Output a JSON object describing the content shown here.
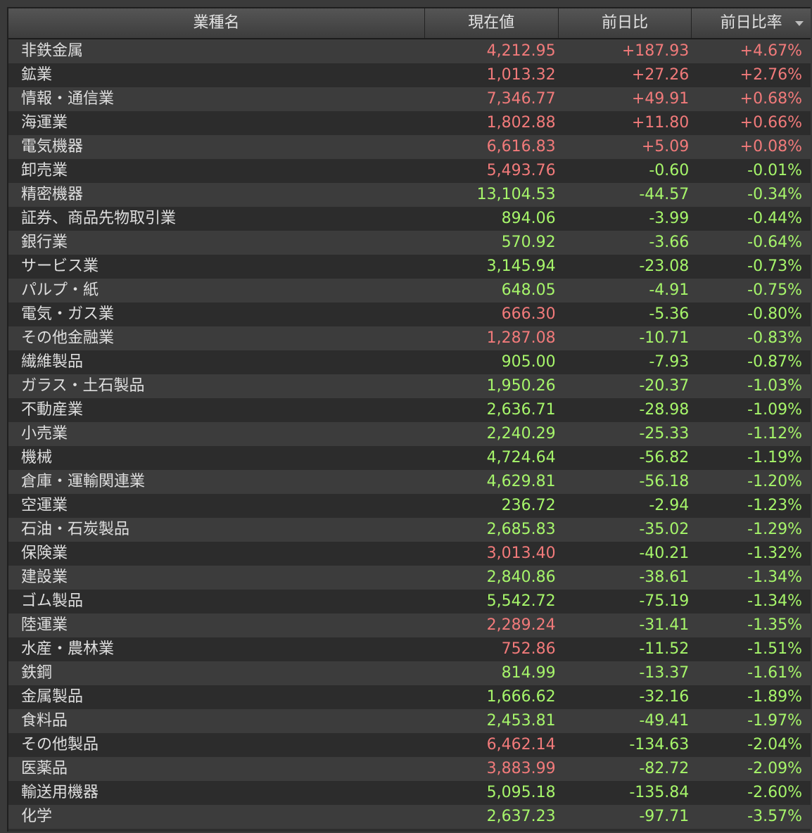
{
  "headers": {
    "name": "業種名",
    "price": "現在値",
    "change": "前日比",
    "change_pct": "前日比率"
  },
  "colors": {
    "up": "#f17a7a",
    "down": "#a6f56a"
  },
  "rows": [
    {
      "name": "非鉄金属",
      "price": "4,212.95",
      "change": "+187.93",
      "pct": "+4.67%",
      "price_color": "red",
      "chg_color": "red"
    },
    {
      "name": "鉱業",
      "price": "1,013.32",
      "change": "+27.26",
      "pct": "+2.76%",
      "price_color": "red",
      "chg_color": "red"
    },
    {
      "name": "情報・通信業",
      "price": "7,346.77",
      "change": "+49.91",
      "pct": "+0.68%",
      "price_color": "red",
      "chg_color": "red"
    },
    {
      "name": "海運業",
      "price": "1,802.88",
      "change": "+11.80",
      "pct": "+0.66%",
      "price_color": "red",
      "chg_color": "red"
    },
    {
      "name": "電気機器",
      "price": "6,616.83",
      "change": "+5.09",
      "pct": "+0.08%",
      "price_color": "red",
      "chg_color": "red"
    },
    {
      "name": "卸売業",
      "price": "5,493.76",
      "change": "-0.60",
      "pct": "-0.01%",
      "price_color": "red",
      "chg_color": "green"
    },
    {
      "name": "精密機器",
      "price": "13,104.53",
      "change": "-44.57",
      "pct": "-0.34%",
      "price_color": "green",
      "chg_color": "green"
    },
    {
      "name": "証券、商品先物取引業",
      "price": "894.06",
      "change": "-3.99",
      "pct": "-0.44%",
      "price_color": "green",
      "chg_color": "green"
    },
    {
      "name": "銀行業",
      "price": "570.92",
      "change": "-3.66",
      "pct": "-0.64%",
      "price_color": "green",
      "chg_color": "green"
    },
    {
      "name": "サービス業",
      "price": "3,145.94",
      "change": "-23.08",
      "pct": "-0.73%",
      "price_color": "green",
      "chg_color": "green"
    },
    {
      "name": "パルプ・紙",
      "price": "648.05",
      "change": "-4.91",
      "pct": "-0.75%",
      "price_color": "green",
      "chg_color": "green"
    },
    {
      "name": "電気・ガス業",
      "price": "666.30",
      "change": "-5.36",
      "pct": "-0.80%",
      "price_color": "red",
      "chg_color": "green"
    },
    {
      "name": "その他金融業",
      "price": "1,287.08",
      "change": "-10.71",
      "pct": "-0.83%",
      "price_color": "red",
      "chg_color": "green"
    },
    {
      "name": "繊維製品",
      "price": "905.00",
      "change": "-7.93",
      "pct": "-0.87%",
      "price_color": "green",
      "chg_color": "green"
    },
    {
      "name": "ガラス・土石製品",
      "price": "1,950.26",
      "change": "-20.37",
      "pct": "-1.03%",
      "price_color": "green",
      "chg_color": "green"
    },
    {
      "name": "不動産業",
      "price": "2,636.71",
      "change": "-28.98",
      "pct": "-1.09%",
      "price_color": "green",
      "chg_color": "green"
    },
    {
      "name": "小売業",
      "price": "2,240.29",
      "change": "-25.33",
      "pct": "-1.12%",
      "price_color": "green",
      "chg_color": "green"
    },
    {
      "name": "機械",
      "price": "4,724.64",
      "change": "-56.82",
      "pct": "-1.19%",
      "price_color": "green",
      "chg_color": "green"
    },
    {
      "name": "倉庫・運輸関連業",
      "price": "4,629.81",
      "change": "-56.18",
      "pct": "-1.20%",
      "price_color": "green",
      "chg_color": "green"
    },
    {
      "name": "空運業",
      "price": "236.72",
      "change": "-2.94",
      "pct": "-1.23%",
      "price_color": "green",
      "chg_color": "green"
    },
    {
      "name": "石油・石炭製品",
      "price": "2,685.83",
      "change": "-35.02",
      "pct": "-1.29%",
      "price_color": "green",
      "chg_color": "green"
    },
    {
      "name": "保険業",
      "price": "3,013.40",
      "change": "-40.21",
      "pct": "-1.32%",
      "price_color": "red",
      "chg_color": "green"
    },
    {
      "name": "建設業",
      "price": "2,840.86",
      "change": "-38.61",
      "pct": "-1.34%",
      "price_color": "green",
      "chg_color": "green"
    },
    {
      "name": "ゴム製品",
      "price": "5,542.72",
      "change": "-75.19",
      "pct": "-1.34%",
      "price_color": "green",
      "chg_color": "green"
    },
    {
      "name": "陸運業",
      "price": "2,289.24",
      "change": "-31.41",
      "pct": "-1.35%",
      "price_color": "red",
      "chg_color": "green"
    },
    {
      "name": "水産・農林業",
      "price": "752.86",
      "change": "-11.52",
      "pct": "-1.51%",
      "price_color": "red",
      "chg_color": "green"
    },
    {
      "name": "鉄鋼",
      "price": "814.99",
      "change": "-13.37",
      "pct": "-1.61%",
      "price_color": "green",
      "chg_color": "green"
    },
    {
      "name": "金属製品",
      "price": "1,666.62",
      "change": "-32.16",
      "pct": "-1.89%",
      "price_color": "green",
      "chg_color": "green"
    },
    {
      "name": "食料品",
      "price": "2,453.81",
      "change": "-49.41",
      "pct": "-1.97%",
      "price_color": "green",
      "chg_color": "green"
    },
    {
      "name": "その他製品",
      "price": "6,462.14",
      "change": "-134.63",
      "pct": "-2.04%",
      "price_color": "red",
      "chg_color": "green"
    },
    {
      "name": "医薬品",
      "price": "3,883.99",
      "change": "-82.72",
      "pct": "-2.09%",
      "price_color": "red",
      "chg_color": "green"
    },
    {
      "name": "輸送用機器",
      "price": "5,095.18",
      "change": "-135.84",
      "pct": "-2.60%",
      "price_color": "green",
      "chg_color": "green"
    },
    {
      "name": "化学",
      "price": "2,637.23",
      "change": "-97.71",
      "pct": "-3.57%",
      "price_color": "green",
      "chg_color": "green"
    }
  ]
}
